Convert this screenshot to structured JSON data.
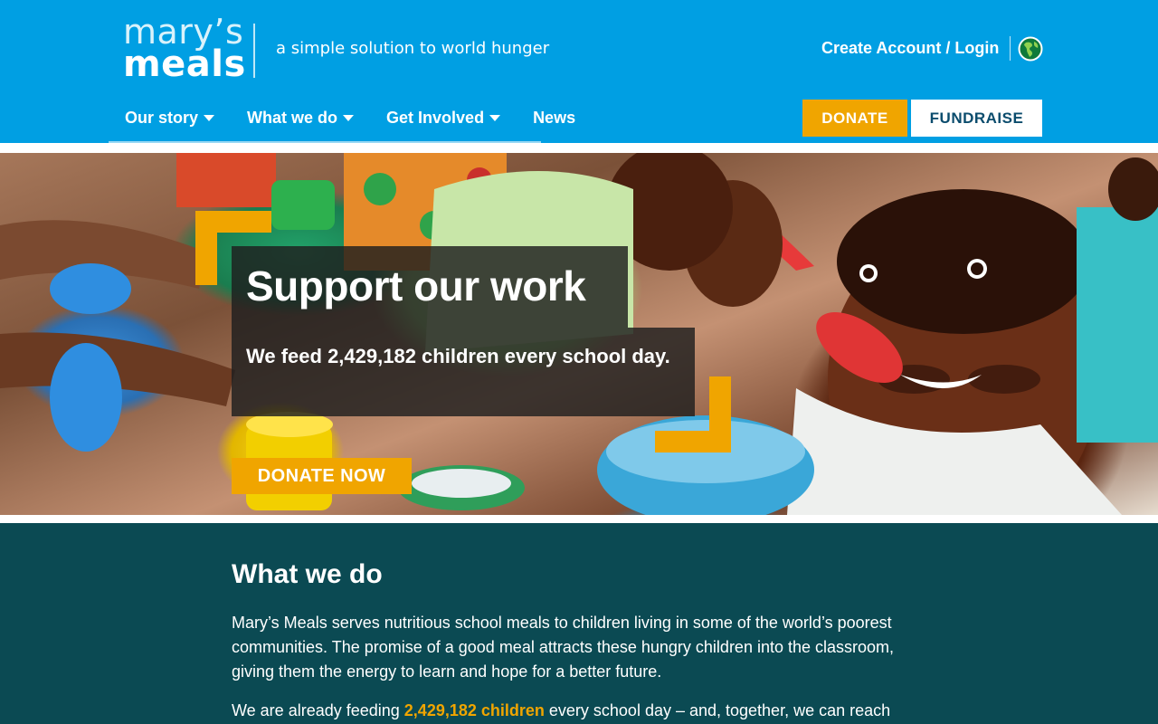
{
  "header": {
    "logo_line1": "mary’s",
    "logo_line2": "meals",
    "tagline": "a simple solution to world hunger",
    "account_link": "Create Account / Login",
    "globe_icon": "globe-icon"
  },
  "nav": {
    "items": [
      {
        "label": "Our story",
        "dropdown": true
      },
      {
        "label": "What we do",
        "dropdown": true
      },
      {
        "label": "Get Involved",
        "dropdown": true
      },
      {
        "label": "News",
        "dropdown": false
      }
    ],
    "donate_label": "DONATE",
    "fundraise_label": "FUNDRAISE"
  },
  "hero": {
    "headline": "Support our work",
    "subtext": "We feed 2,429,182 children every school day.",
    "cta_label": "DONATE NOW"
  },
  "what_we_do": {
    "title": "What we do",
    "paragraph1": "Mary’s Meals serves nutritious school meals to children living in some of the world’s poorest communities. The promise of a good meal attracts these hungry children into the classroom, giving them the energy to learn and hope for a better future.",
    "paragraph2_prefix": "We are already feeding ",
    "paragraph2_highlight": "2,429,182 children",
    "paragraph2_suffix": " every school day – and, together, we can reach"
  },
  "colors": {
    "brand_blue": "#009fe3",
    "accent_orange": "#f0a500",
    "dark_teal": "#0b4a53",
    "fundraise_text": "#0b4c6d"
  }
}
